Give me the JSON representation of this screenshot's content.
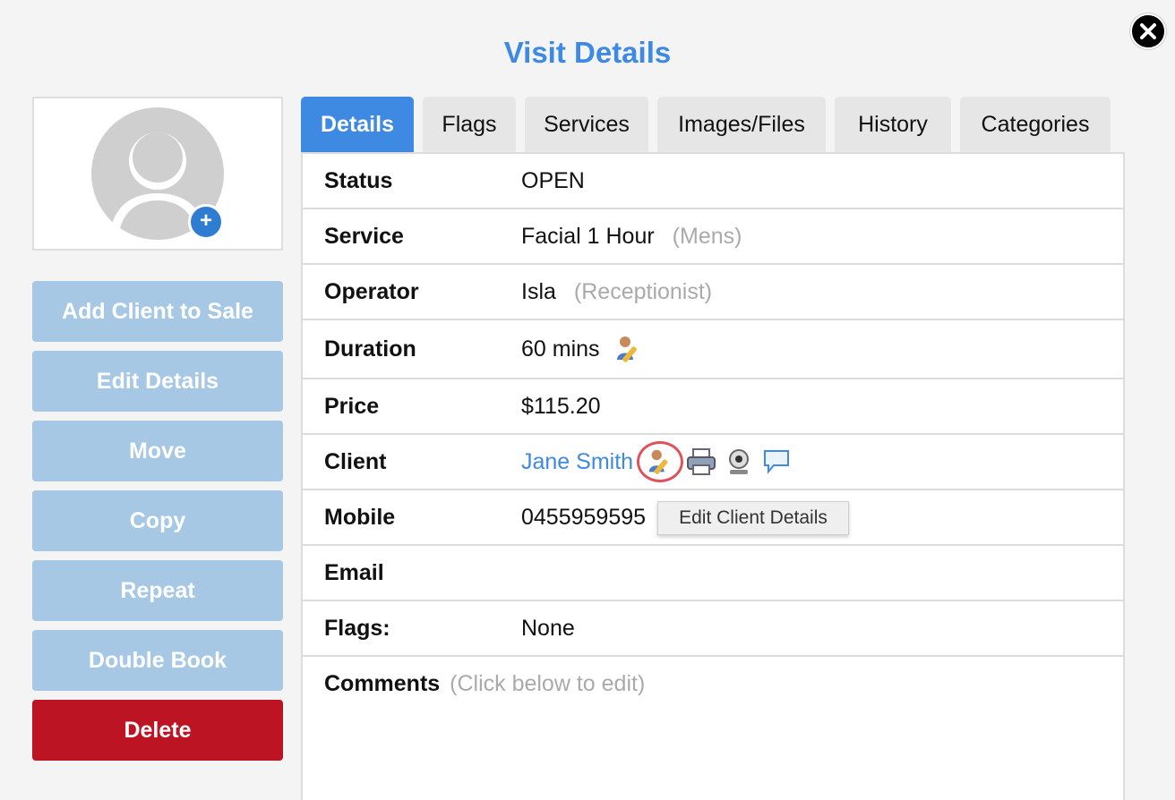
{
  "title": "Visit Details",
  "sidebar": {
    "buttons": [
      {
        "label": "Add Client to Sale"
      },
      {
        "label": "Edit Details"
      },
      {
        "label": "Move"
      },
      {
        "label": "Copy"
      },
      {
        "label": "Repeat"
      },
      {
        "label": "Double Book"
      },
      {
        "label": "Delete"
      }
    ]
  },
  "tabs": [
    {
      "label": "Details"
    },
    {
      "label": "Flags"
    },
    {
      "label": "Services"
    },
    {
      "label": "Images/Files"
    },
    {
      "label": "History"
    },
    {
      "label": "Categories"
    }
  ],
  "details": {
    "status": {
      "label": "Status",
      "value": "OPEN"
    },
    "service": {
      "label": "Service",
      "value": "Facial 1 Hour",
      "note": "(Mens)"
    },
    "operator": {
      "label": "Operator",
      "value": "Isla",
      "note": "(Receptionist)"
    },
    "duration": {
      "label": "Duration",
      "value": "60 mins"
    },
    "price": {
      "label": "Price",
      "value": "$115.20"
    },
    "client": {
      "label": "Client",
      "value": "Jane Smith"
    },
    "mobile": {
      "label": "Mobile",
      "value": "0455959595"
    },
    "email": {
      "label": "Email",
      "value": ""
    },
    "flags": {
      "label": "Flags:",
      "value": "None"
    },
    "comments": {
      "label": "Comments",
      "note": "(Click below to edit)"
    }
  },
  "tooltip": "Edit Client Details",
  "colors": {
    "accent": "#3e89e2",
    "sidebar_button": "#a6c8e5",
    "danger": "#bd1424",
    "highlight_ring": "#e0525a"
  },
  "icons": [
    "close-icon",
    "avatar-placeholder-icon",
    "add-photo-icon",
    "edit-person-icon",
    "print-icon",
    "webcam-icon",
    "speech-bubble-icon"
  ]
}
